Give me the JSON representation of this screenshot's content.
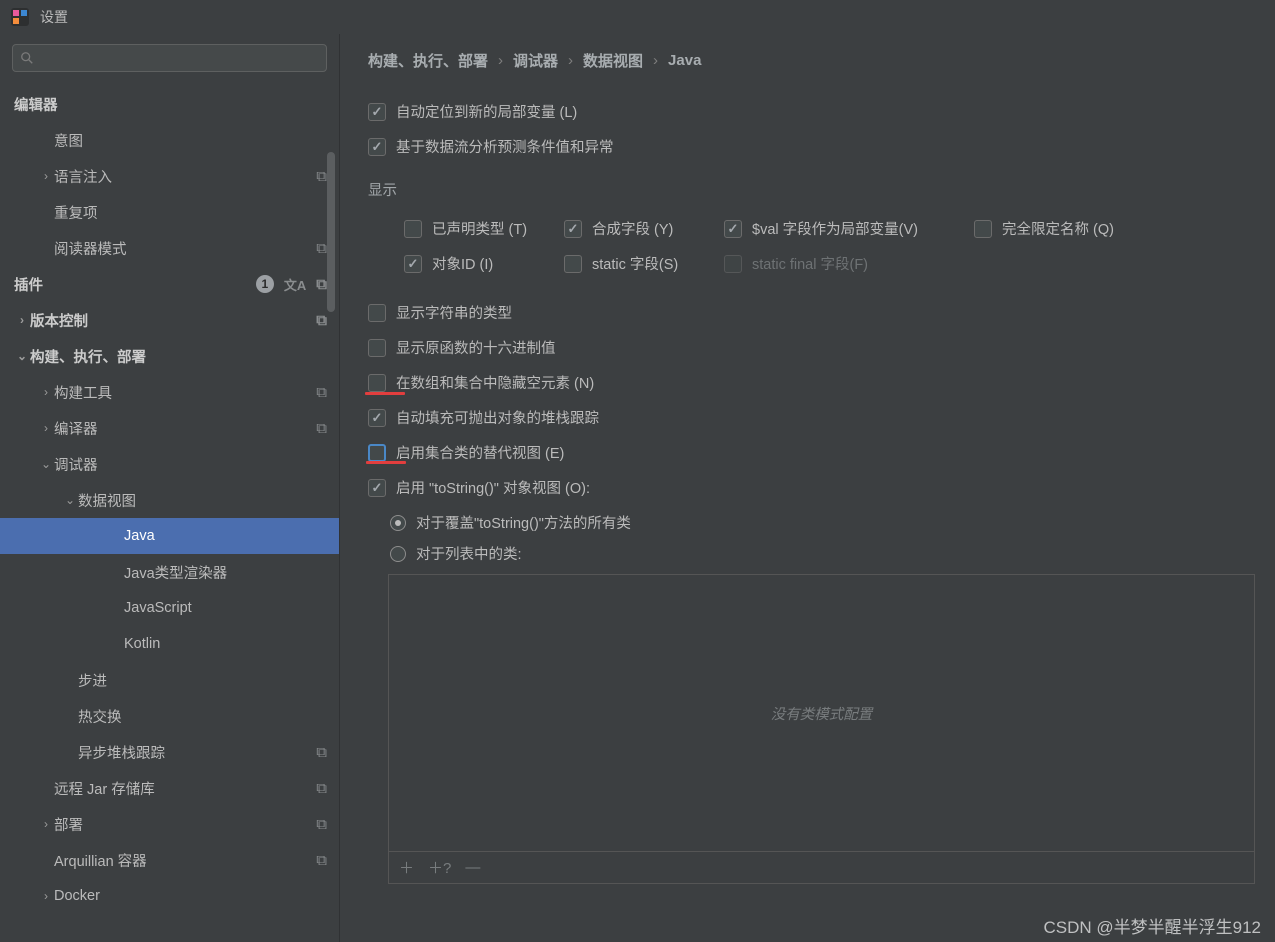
{
  "window": {
    "title": "设置"
  },
  "search": {
    "placeholder": ""
  },
  "sidebar": {
    "items": [
      {
        "label": "编辑器",
        "kind": "header",
        "pad": 0
      },
      {
        "label": "意图",
        "kind": "item",
        "pad": 1
      },
      {
        "label": "语言注入",
        "kind": "expandable",
        "pad": 1,
        "arrow": "›",
        "mod": true
      },
      {
        "label": "重复项",
        "kind": "item",
        "pad": 1
      },
      {
        "label": "阅读器模式",
        "kind": "item",
        "pad": 1,
        "mod": true
      },
      {
        "label": "插件",
        "kind": "header",
        "pad": 0,
        "badge": "1",
        "aa": true,
        "mod": true
      },
      {
        "label": "版本控制",
        "kind": "expandable",
        "pad": 0,
        "arrow": "›",
        "mod": true,
        "header": true
      },
      {
        "label": "构建、执行、部署",
        "kind": "expandable",
        "pad": 0,
        "arrow": "⌄",
        "header": true
      },
      {
        "label": "构建工具",
        "kind": "expandable",
        "pad": 1,
        "arrow": "›",
        "mod": true
      },
      {
        "label": "编译器",
        "kind": "expandable",
        "pad": 1,
        "arrow": "›",
        "mod": true
      },
      {
        "label": "调试器",
        "kind": "expandable",
        "pad": 1,
        "arrow": "⌄"
      },
      {
        "label": "数据视图",
        "kind": "expandable",
        "pad": 2,
        "arrow": "⌄"
      },
      {
        "label": "Java",
        "kind": "item",
        "pad": 4,
        "selected": true
      },
      {
        "label": "Java类型渲染器",
        "kind": "item",
        "pad": 4
      },
      {
        "label": "JavaScript",
        "kind": "item",
        "pad": 4
      },
      {
        "label": "Kotlin",
        "kind": "item",
        "pad": 4
      },
      {
        "label": "步进",
        "kind": "item",
        "pad": 2
      },
      {
        "label": "热交换",
        "kind": "item",
        "pad": 2
      },
      {
        "label": "异步堆栈跟踪",
        "kind": "item",
        "pad": 2,
        "mod": true
      },
      {
        "label": "远程 Jar 存储库",
        "kind": "item",
        "pad": 1,
        "mod": true
      },
      {
        "label": "部署",
        "kind": "expandable",
        "pad": 1,
        "arrow": "›",
        "mod": true
      },
      {
        "label": "Arquillian 容器",
        "kind": "item",
        "pad": 1,
        "mod": true
      },
      {
        "label": "Docker",
        "kind": "expandable",
        "pad": 1,
        "arrow": "›"
      }
    ]
  },
  "breadcrumb": [
    "构建、执行、部署",
    "调试器",
    "数据视图",
    "Java"
  ],
  "top_checks": [
    {
      "label": "自动定位到新的局部变量 (L)",
      "checked": true
    },
    {
      "label": "基于数据流分析预测条件值和异常",
      "checked": true
    }
  ],
  "display_section": "显示",
  "display_grid": {
    "row1": [
      {
        "label": "已声明类型 (T)",
        "checked": false
      },
      {
        "label": "合成字段 (Y)",
        "checked": true
      },
      {
        "label": "$val 字段作为局部变量(V)",
        "checked": true
      },
      {
        "label": "完全限定名称 (Q)",
        "checked": false
      }
    ],
    "row2": [
      {
        "label": "对象ID (I)",
        "checked": true
      },
      {
        "label": "static 字段(S)",
        "checked": false
      },
      {
        "label": "static final 字段(F)",
        "checked": false,
        "disabled": true
      }
    ]
  },
  "options": [
    {
      "label": "显示字符串的类型",
      "checked": false
    },
    {
      "label": "显示原函数的十六进制值",
      "checked": false
    },
    {
      "label": "在数组和集合中隐藏空元素 (N)",
      "checked": false,
      "red": true
    },
    {
      "label": "自动填充可抛出对象的堆栈跟踪",
      "checked": true
    },
    {
      "label": "启用集合类的替代视图 (E)",
      "checked": false,
      "highlight": true,
      "red": true
    },
    {
      "label": "启用 \"toString()\" 对象视图 (O):",
      "checked": true
    }
  ],
  "radios": [
    {
      "label": "对于覆盖\"toString()\"方法的所有类",
      "selected": true
    },
    {
      "label": "对于列表中的类:",
      "selected": false
    }
  ],
  "classes_box": {
    "empty_text": "没有类模式配置",
    "toolbar": [
      "＋",
      "＋?",
      "—"
    ]
  },
  "watermark": "CSDN @半梦半醒半浮生912"
}
